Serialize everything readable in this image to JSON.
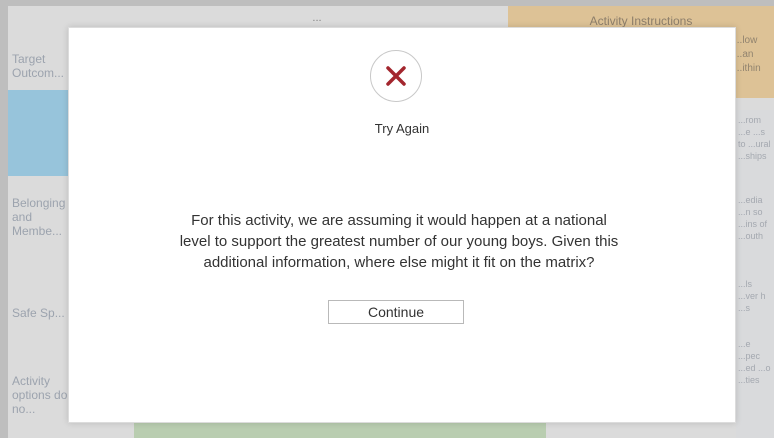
{
  "background": {
    "title": "...",
    "instructions": {
      "title": "Activity Instructions",
      "side_text": "...low ...an ...ithin"
    },
    "left_column": [
      {
        "label": "Target Outcom..."
      },
      {
        "label": "Belonging and Membe..."
      },
      {
        "label": "Safe Sp..."
      },
      {
        "label": "Activity options do no..."
      }
    ],
    "right_column": [
      {
        "label": "...rom ...e ...s to ...ural ...ships"
      },
      {
        "label": "...edia ...n so ...ins of ...outh"
      },
      {
        "label": "...ls ...ver h ...s"
      },
      {
        "label": "...e ...pec ...ed ...o ...ties"
      }
    ]
  },
  "modal": {
    "status_icon": "close-x-icon",
    "status_color": "#a3262e",
    "title": "Try Again",
    "message": "For this activity, we are assuming it would happen at a national level to support the greatest number of our young boys. Given this additional information, where else might it fit on the matrix?",
    "continue_label": "Continue"
  }
}
